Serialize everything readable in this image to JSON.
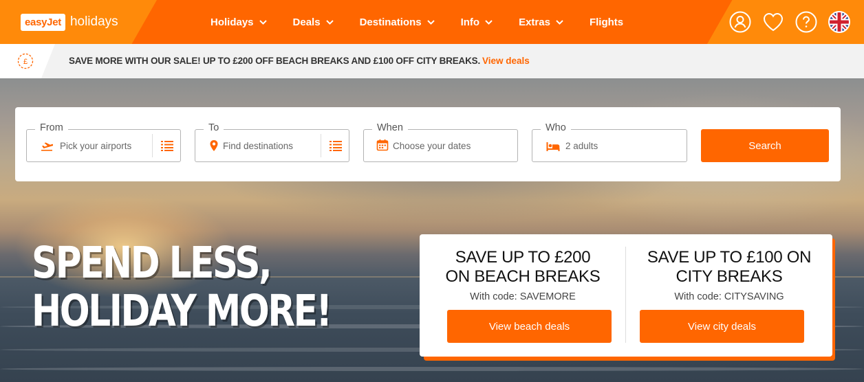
{
  "brand": {
    "logo_badge": "easyJet",
    "logo_word": "holidays"
  },
  "nav": {
    "items": [
      {
        "label": "Holidays",
        "has_dropdown": true
      },
      {
        "label": "Deals",
        "has_dropdown": true
      },
      {
        "label": "Destinations",
        "has_dropdown": true
      },
      {
        "label": "Info",
        "has_dropdown": true
      },
      {
        "label": "Extras",
        "has_dropdown": true
      },
      {
        "label": "Flights",
        "has_dropdown": false
      }
    ],
    "icons": [
      "account-icon",
      "heart-icon",
      "help-icon",
      "uk-flag-icon"
    ]
  },
  "banner": {
    "text": "SAVE MORE WITH OUR SALE! UP TO £200 OFF BEACH BREAKS AND £100 OFF CITY BREAKS.",
    "link": "View deals",
    "icon": "pound-coin-icon"
  },
  "search": {
    "from": {
      "legend": "From",
      "placeholder": "Pick your airports"
    },
    "to": {
      "legend": "To",
      "placeholder": "Find destinations"
    },
    "when": {
      "legend": "When",
      "placeholder": "Choose your dates"
    },
    "who": {
      "legend": "Who",
      "value": "2 adults"
    },
    "button": "Search"
  },
  "hero": {
    "headline_line1": "SPEND LESS,",
    "headline_line2": "HOLIDAY MORE!"
  },
  "offers": {
    "beach": {
      "title_line1": "SAVE UP TO £200",
      "title_line2": "ON BEACH BREAKS",
      "code": "With code: SAVEMORE",
      "button": "View beach deals"
    },
    "city": {
      "title_line1": "SAVE UP TO £100 ON",
      "title_line2": "CITY BREAKS",
      "code": "With code: CITYSAVING",
      "button": "View city deals"
    }
  },
  "colors": {
    "brand_orange": "#ff6600",
    "tab_orange": "#ff8a0a",
    "banner_bg": "#f2f2f2"
  }
}
